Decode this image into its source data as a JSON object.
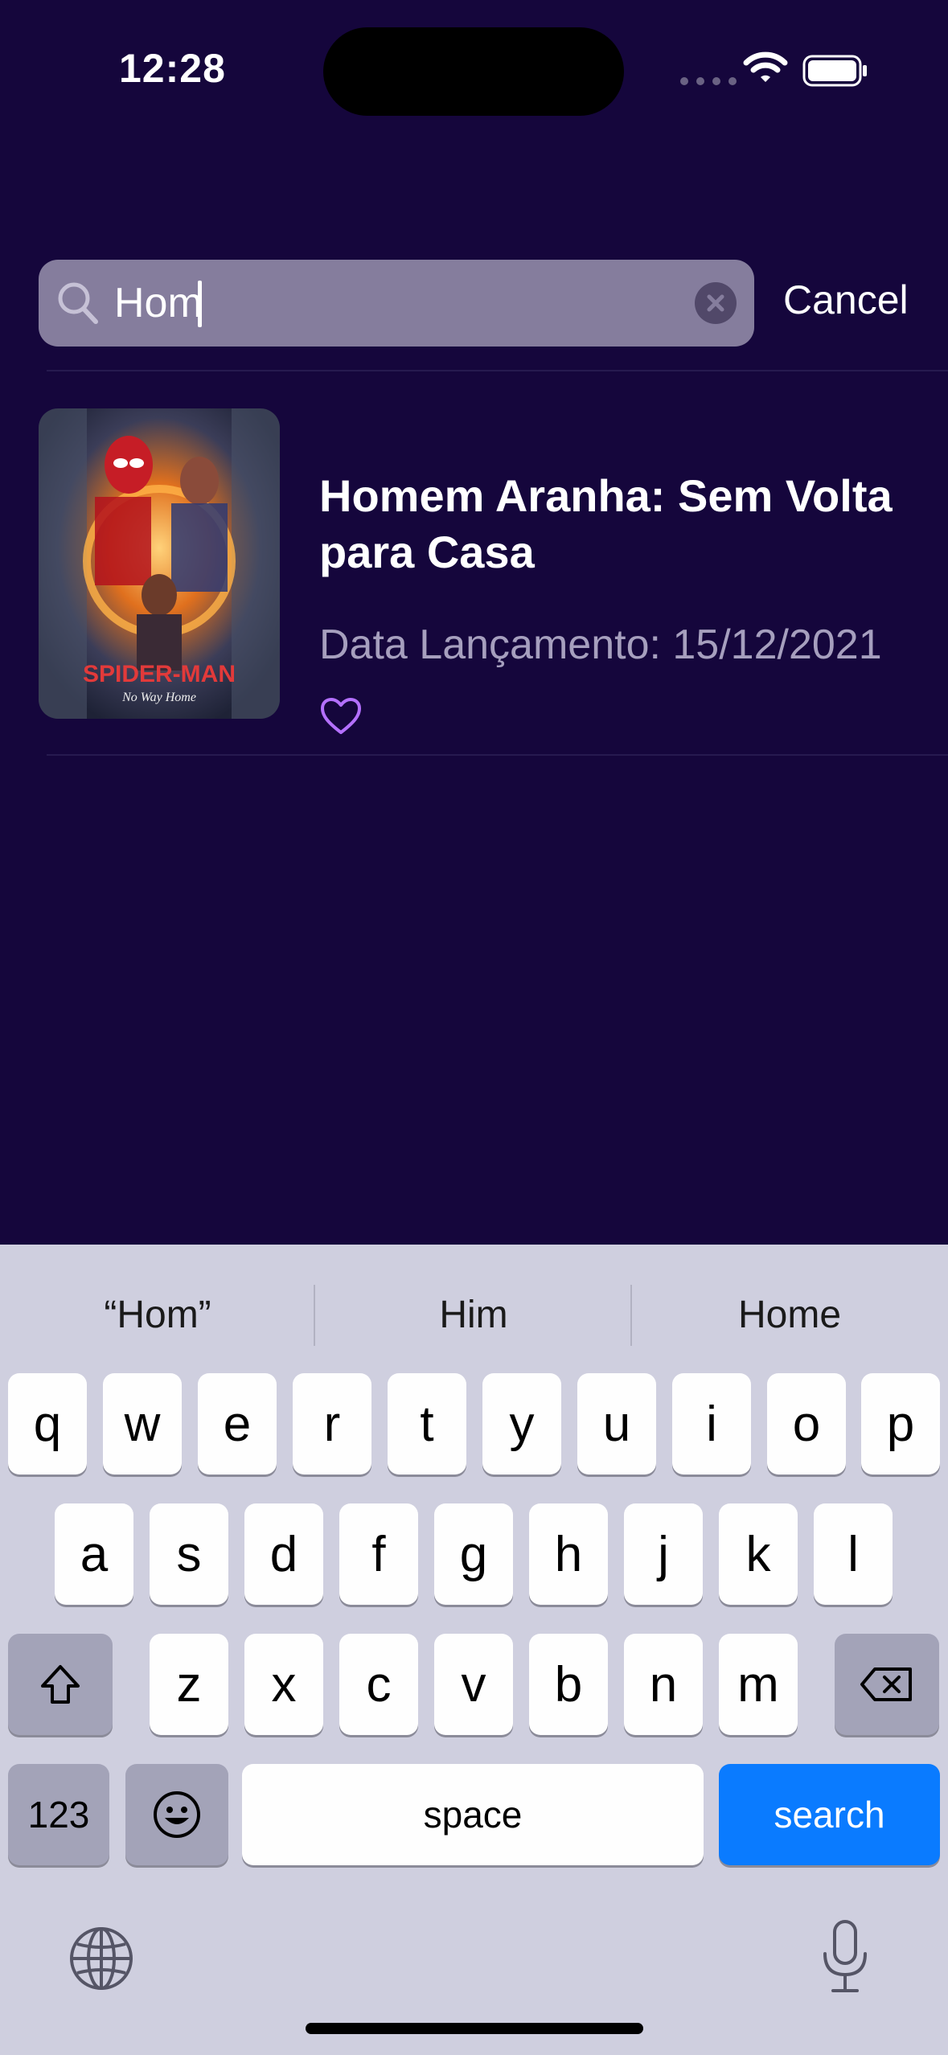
{
  "status": {
    "time": "12:28"
  },
  "search": {
    "value": "Hom",
    "cancel_label": "Cancel"
  },
  "results": [
    {
      "title": "Homem Aranha: Sem Volta para Casa",
      "release": "Data Lançamento: 15/12/2021",
      "poster_title": "SPIDER-MAN",
      "poster_subtitle": "No Way Home",
      "favorite": false
    }
  ],
  "keyboard": {
    "suggestions": [
      "“Hom”",
      "Him",
      "Home"
    ],
    "row1": [
      "q",
      "w",
      "e",
      "r",
      "t",
      "y",
      "u",
      "i",
      "o",
      "p"
    ],
    "row2": [
      "a",
      "s",
      "d",
      "f",
      "g",
      "h",
      "j",
      "k",
      "l"
    ],
    "row3": [
      "z",
      "x",
      "c",
      "v",
      "b",
      "n",
      "m"
    ],
    "numbers_label": "123",
    "space_label": "space",
    "search_label": "search"
  },
  "colors": {
    "background": "#15063c",
    "accent": "#b470ff",
    "search_key": "#0a7bff"
  }
}
